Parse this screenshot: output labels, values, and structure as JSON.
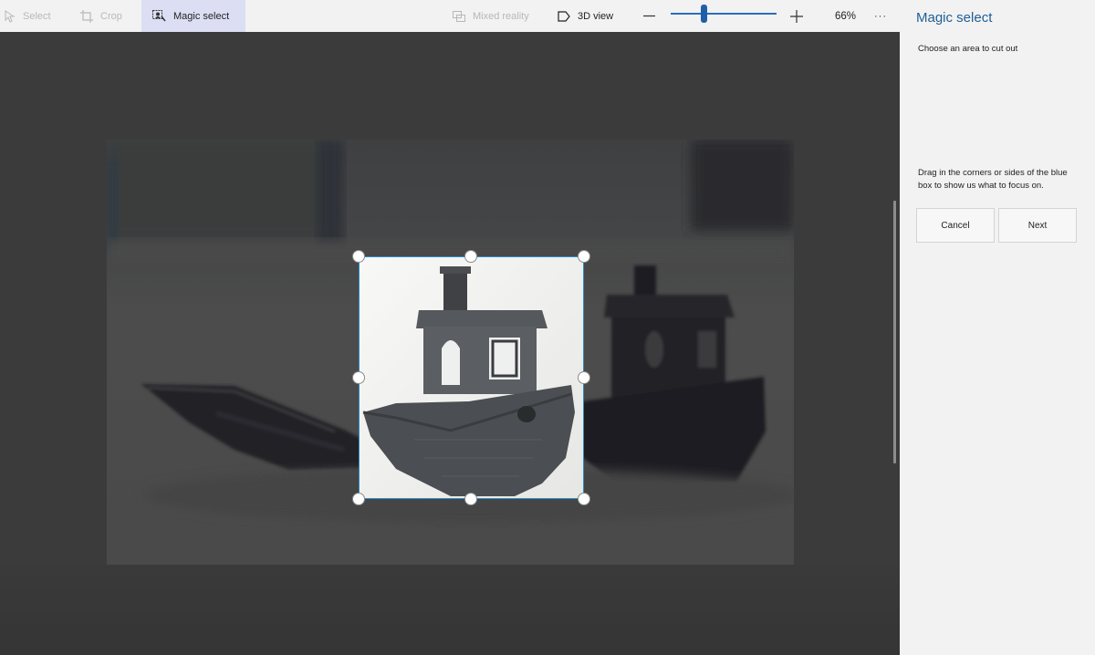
{
  "toolbar": {
    "select_label": "Select",
    "crop_label": "Crop",
    "magic_select_label": "Magic select",
    "mixed_reality_label": "Mixed reality",
    "view3d_label": "3D view",
    "zoom_level": "66%",
    "zoom_fraction": 0.3,
    "more_label": "···"
  },
  "panel": {
    "title": "Magic select",
    "subtitle": "Choose an area to cut out",
    "instructions": "Drag in the corners or sides of the blue box to show us what to focus on.",
    "cancel_label": "Cancel",
    "next_label": "Next"
  },
  "colors": {
    "accent": "#1f5f95",
    "selection_border": "#2d8fc9",
    "active_tool_bg": "#dcdff3"
  }
}
